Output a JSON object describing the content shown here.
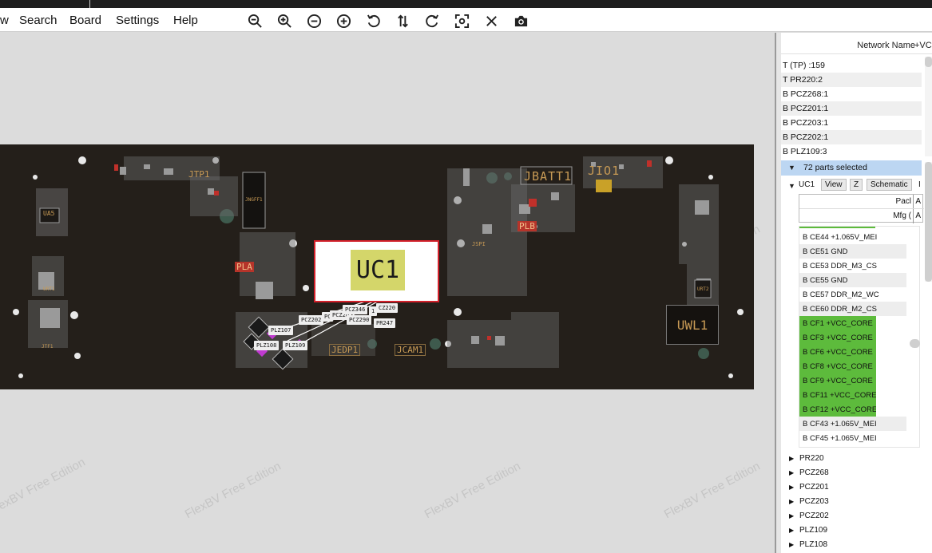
{
  "menu": {
    "items": [
      "w",
      "Search",
      "Board",
      "Settings",
      "Help"
    ]
  },
  "toolbar": {
    "icons": [
      "zoom-out-icon",
      "zoom-in-icon",
      "minus-circle-icon",
      "plus-circle-icon",
      "rotate-ccw-icon",
      "flip-icon",
      "rotate-cw-icon",
      "fit-icon",
      "close-icon",
      "camera-icon"
    ]
  },
  "watermark": "FlexBV Free Edition",
  "board": {
    "labels": {
      "uc1": "UC1",
      "uwl1": "UWL1",
      "jbatt1": "JBATT1",
      "jio1": "JIO1",
      "jtp1": "JTP1",
      "jedp1": "JEDP1",
      "jcam1": "JCAM1",
      "pla": "PLA",
      "plb": "PLB",
      "jngff1": "JNGFF1",
      "ua5": "UA5",
      "jspi": "JSPI",
      "urt1": "URT1",
      "urt2": "URT2",
      "jtf1": "JTF1"
    },
    "chips": {
      "pcz2202": "PCZ202",
      "pc": "PC",
      "pcz2x": "PCZ2o",
      "pcz346": "PCZ346",
      "pcz2xx": "1",
      "pcz220": "CZ220",
      "pcz290": "PCZ290",
      "pr247": "PR247",
      "plz107": "PLZ107",
      "plz108": "PLZ108",
      "plz109": "PLZ109"
    }
  },
  "panel": {
    "network_header": {
      "label": "Network Name",
      "value": "+VCC"
    },
    "net_rows": [
      "T  (TP) :159",
      "T  PR220:2",
      "B PCZ268:1",
      "B PCZ201:1",
      "B PCZ203:1",
      "B PCZ202:1",
      "B PLZ109:3"
    ],
    "selection_header": "72 parts selected",
    "part": {
      "name": "UC1",
      "buttons": [
        "View",
        "Z",
        "Schematic",
        "I"
      ],
      "info_rows": [
        {
          "key": "Pacl",
          "val": "A"
        },
        {
          "key": "Mfg (",
          "val": "A"
        }
      ]
    },
    "pins": [
      {
        "text": "B CE44  +1.065V_MEI",
        "hl": false
      },
      {
        "text": "B CE51  GND",
        "hl": false
      },
      {
        "text": "B CE53  DDR_M3_CS",
        "hl": false
      },
      {
        "text": "B CE55  GND",
        "hl": false
      },
      {
        "text": "B CE57  DDR_M2_WC",
        "hl": false
      },
      {
        "text": "B CE60  DDR_M2_CS",
        "hl": false
      },
      {
        "text": "B CF1 +VCC_CORE",
        "hl": true
      },
      {
        "text": "B CF3 +VCC_CORE",
        "hl": true
      },
      {
        "text": "B CF6 +VCC_CORE",
        "hl": true
      },
      {
        "text": "B CF8 +VCC_CORE",
        "hl": true
      },
      {
        "text": "B CF9 +VCC_CORE",
        "hl": true
      },
      {
        "text": "B CF11 +VCC_CORE",
        "hl": true
      },
      {
        "text": "B CF12 +VCC_CORE",
        "hl": true
      },
      {
        "text": "B CF43  +1.065V_MEI",
        "hl": false
      },
      {
        "text": "B CF45  +1.065V_MEI",
        "hl": false
      }
    ],
    "tree": [
      "PR220",
      "PCZ268",
      "PCZ201",
      "PCZ203",
      "PCZ202",
      "PLZ109",
      "PLZ108"
    ]
  }
}
